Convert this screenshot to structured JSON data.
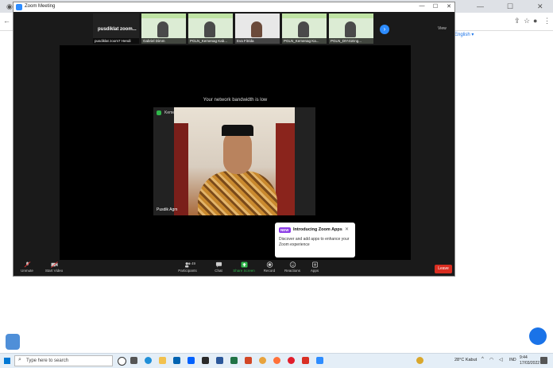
{
  "browser": {
    "lang_link": "English ▾"
  },
  "zoom": {
    "window_title": "Zoom Meeting",
    "controls": {
      "minimize": "—",
      "maximize": "☐",
      "close": "✕"
    },
    "name_tile": "pusdiklat zoom...",
    "thumbnails": [
      {
        "name": "pusdiklat zoom7 Hendi"
      },
      {
        "name": "Gabriel Dimm"
      },
      {
        "name": "PGLN_Kemenag Kab..."
      },
      {
        "name": "Eva Fitrida"
      },
      {
        "name": "PGLN_Kemenag Ka..."
      },
      {
        "name": "PGLN_DIY41Eng..."
      }
    ],
    "view_label": "View",
    "bandwidth_message": "Your network bandwidth is low",
    "speaker_label": "Pusdik Agm",
    "speaker_top_label": "Kemenag",
    "popup": {
      "badge": "NEW",
      "title": "Introducing Zoom Apps",
      "body": "Discover and add apps to enhance your Zoom experience",
      "close": "✕"
    },
    "toolbar": {
      "unmute": "Unmute",
      "start_video": "Start Video",
      "participants": "Participants",
      "participants_count": "49",
      "chat": "Chat",
      "share_screen": "Share Screen",
      "record": "Record",
      "reactions": "Reactions",
      "apps": "Apps",
      "leave": "Leave"
    }
  },
  "taskbar": {
    "search_placeholder": "Type here to search",
    "weather": "28°C  Kabut",
    "lang": "IND",
    "time": "9:44",
    "date": "17/03/2022"
  },
  "colors": {
    "zoom_blue": "#2d8cff",
    "leave_red": "#d92d20",
    "share_green": "#2fb84a"
  }
}
